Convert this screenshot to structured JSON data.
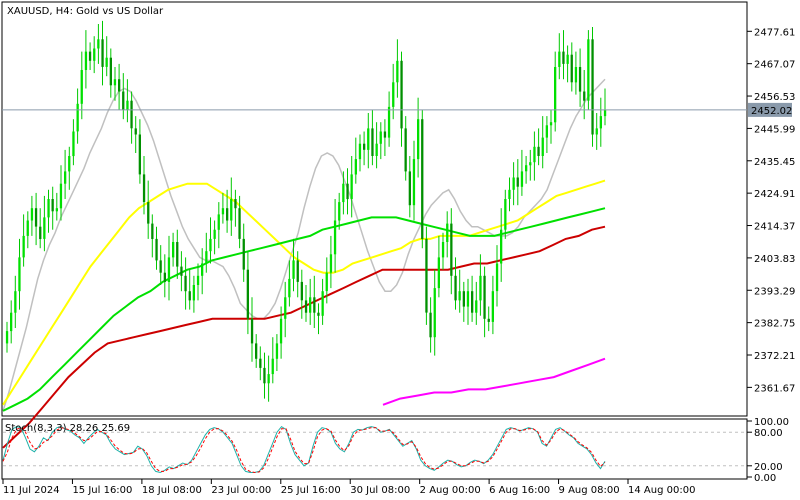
{
  "chart_data": {
    "type": "line",
    "title": "XAUUSD, H4:  Gold vs US Dollar",
    "symbol": "XAUUSD",
    "timeframe": "H4",
    "description": "Gold vs US Dollar",
    "price_axis": {
      "ylim": [
        2353.0,
        2486.5
      ],
      "ticks": [
        "2477.61",
        "2467.07",
        "2456.53",
        "2445.99",
        "2435.45",
        "2424.91",
        "2414.37",
        "2403.83",
        "2393.29",
        "2382.75",
        "2372.21",
        "2361.67"
      ]
    },
    "current_price": "2452.02",
    "time_axis": {
      "labels": [
        "11 Jul 2024",
        "15 Jul 16:00",
        "18 Jul 08:00",
        "23 Jul 00:00",
        "25 Jul 16:00",
        "30 Jul 08:00",
        "2 Aug 00:00",
        "6 Aug 16:00",
        "9 Aug 08:00",
        "14 Aug 00:00"
      ]
    },
    "candles_close": [
      2380,
      2386,
      2393,
      2404,
      2411,
      2416,
      2420,
      2414,
      2410,
      2417,
      2423,
      2419,
      2420,
      2428,
      2432,
      2437,
      2445,
      2454,
      2465,
      2471,
      2468,
      2472,
      2475,
      2466,
      2469,
      2460,
      2462,
      2458,
      2452,
      2455,
      2446,
      2444,
      2431,
      2422,
      2415,
      2410,
      2403,
      2399,
      2396,
      2404,
      2409,
      2401,
      2398,
      2393,
      2390,
      2395,
      2398,
      2402,
      2406,
      2410,
      2413,
      2418,
      2420,
      2416,
      2423,
      2420,
      2410,
      2400,
      2384,
      2376,
      2371,
      2368,
      2363,
      2366,
      2371,
      2376,
      2384,
      2391,
      2397,
      2403,
      2396,
      2390,
      2386,
      2391,
      2386,
      2385,
      2393,
      2399,
      2405,
      2416,
      2422,
      2428,
      2423,
      2431,
      2436,
      2441,
      2439,
      2446,
      2437,
      2441,
      2445,
      2443,
      2453,
      2461,
      2468,
      2446,
      2432,
      2421,
      2436,
      2449,
      2410,
      2386,
      2378,
      2394,
      2404,
      2409,
      2415,
      2398,
      2390,
      2393,
      2388,
      2393,
      2386,
      2390,
      2398,
      2384,
      2383,
      2393,
      2402,
      2413,
      2423,
      2426,
      2430,
      2427,
      2432,
      2434,
      2435,
      2440,
      2437,
      2443,
      2447,
      2448,
      2466,
      2471,
      2467,
      2470,
      2461,
      2466,
      2458,
      2455,
      2475,
      2444,
      2446,
      2450,
      2452
    ],
    "series": [
      {
        "name": "MA20 (silver)",
        "color": "#c0c0c0",
        "values": [
          2354,
          2360,
          2367,
          2374,
          2381,
          2389,
          2397,
          2403,
          2408,
          2412,
          2417,
          2421,
          2425,
          2429,
          2433,
          2438,
          2442,
          2446,
          2451,
          2455,
          2458,
          2459,
          2458,
          2455,
          2451,
          2447,
          2442,
          2436,
          2430,
          2424,
          2419,
          2414,
          2410,
          2407,
          2404,
          2403,
          2403,
          2402,
          2401,
          2398,
          2394,
          2389,
          2387,
          2385,
          2384,
          2384,
          2386,
          2389,
          2394,
          2400,
          2406,
          2412,
          2420,
          2427,
          2433,
          2437,
          2438,
          2437,
          2434,
          2429,
          2424,
          2418,
          2412,
          2406,
          2401,
          2396,
          2393,
          2393,
          2395,
          2399,
          2405,
          2410,
          2414,
          2418,
          2421,
          2423,
          2425,
          2426,
          2423,
          2419,
          2416,
          2414,
          2414,
          2413,
          2412,
          2411,
          2411,
          2411,
          2412,
          2414,
          2417,
          2419,
          2421,
          2423,
          2426,
          2431,
          2436,
          2441,
          2446,
          2450,
          2453,
          2456,
          2458,
          2460,
          2462
        ]
      },
      {
        "name": "MA50 (yellow)",
        "color": "#ffff00",
        "values": [
          2356,
          2361,
          2366,
          2371,
          2376,
          2381,
          2386,
          2391,
          2396,
          2401,
          2405,
          2409,
          2413,
          2417,
          2420,
          2422,
          2424,
          2426,
          2427,
          2428,
          2428,
          2428,
          2426,
          2424,
          2422,
          2419,
          2416,
          2413,
          2410,
          2407,
          2404,
          2402,
          2400,
          2399,
          2399,
          2400,
          2402,
          2403,
          2404,
          2405,
          2406,
          2407,
          2409,
          2410,
          2410,
          2411,
          2411,
          2411,
          2411,
          2412,
          2413,
          2414,
          2415,
          2416,
          2418,
          2420,
          2422,
          2424,
          2425,
          2426,
          2427,
          2428,
          2429
        ]
      },
      {
        "name": "MA100 (green)",
        "color": "#00e000",
        "values": [
          2354,
          2356,
          2358,
          2361,
          2365,
          2369,
          2373,
          2377,
          2381,
          2385,
          2388,
          2391,
          2393,
          2396,
          2398,
          2400,
          2401,
          2403,
          2404,
          2405,
          2406,
          2407,
          2408,
          2409,
          2410,
          2411,
          2413,
          2414,
          2415,
          2416,
          2417,
          2417,
          2417,
          2416,
          2415,
          2414,
          2413,
          2412,
          2411,
          2411,
          2411,
          2412,
          2413,
          2414,
          2415,
          2416,
          2417,
          2418,
          2419,
          2420
        ]
      },
      {
        "name": "MA200 (red)",
        "color": "#cc0000",
        "values": [
          2342,
          2346,
          2350,
          2355,
          2360,
          2365,
          2369,
          2373,
          2376,
          2377,
          2378,
          2379,
          2380,
          2381,
          2382,
          2383,
          2384,
          2384,
          2384,
          2384,
          2384,
          2385,
          2386,
          2388,
          2390,
          2392,
          2394,
          2396,
          2398,
          2400,
          2400,
          2400,
          2400,
          2400,
          2400,
          2401,
          2402,
          2402,
          2403,
          2404,
          2405,
          2406,
          2408,
          2410,
          2411,
          2413,
          2414
        ]
      },
      {
        "name": "MA (magenta)",
        "color": "#ff00ff",
        "values": [
          2356,
          2358,
          2359,
          2360,
          2360,
          2361,
          2361,
          2362,
          2363,
          2364,
          2365,
          2367,
          2369,
          2371
        ]
      }
    ],
    "stochastic": {
      "label": "Stoch(8,3,3) 28.26 25.69",
      "main_value": 28.26,
      "signal_value": 25.69,
      "ylim": [
        0,
        100
      ],
      "levels": [
        80,
        20
      ],
      "ticks": [
        "100.00",
        "80.00",
        "20.00",
        "0.00"
      ],
      "main": [
        30,
        60,
        85,
        90,
        88,
        70,
        50,
        45,
        55,
        70,
        65,
        80,
        88,
        90,
        85,
        82,
        75,
        70,
        60,
        70,
        78,
        85,
        80,
        75,
        60,
        50,
        45,
        40,
        42,
        44,
        55,
        50,
        38,
        20,
        10,
        8,
        12,
        18,
        15,
        20,
        25,
        22,
        30,
        45,
        60,
        75,
        85,
        88,
        86,
        80,
        70,
        60,
        40,
        20,
        10,
        8,
        8,
        10,
        20,
        40,
        60,
        80,
        90,
        85,
        60,
        40,
        30,
        20,
        25,
        55,
        80,
        88,
        86,
        80,
        60,
        50,
        45,
        60,
        80,
        85,
        84,
        88,
        90,
        88,
        80,
        82,
        85,
        75,
        65,
        55,
        60,
        65,
        50,
        30,
        20,
        15,
        12,
        18,
        25,
        30,
        28,
        22,
        18,
        20,
        26,
        30,
        28,
        24,
        30,
        40,
        55,
        70,
        85,
        88,
        86,
        82,
        85,
        88,
        86,
        80,
        60,
        55,
        70,
        85,
        88,
        82,
        75,
        70,
        60,
        55,
        50,
        40,
        25,
        15,
        28
      ],
      "signal": [
        28,
        45,
        70,
        85,
        88,
        80,
        62,
        50,
        52,
        62,
        66,
        74,
        84,
        88,
        86,
        84,
        78,
        72,
        65,
        67,
        74,
        81,
        81,
        77,
        66,
        55,
        48,
        42,
        41,
        43,
        50,
        51,
        43,
        28,
        15,
        10,
        10,
        15,
        15,
        18,
        22,
        23,
        27,
        38,
        52,
        68,
        80,
        86,
        86,
        82,
        74,
        64,
        48,
        28,
        14,
        10,
        8,
        9,
        16,
        32,
        52,
        72,
        86,
        86,
        68,
        46,
        34,
        24,
        24,
        46,
        72,
        84,
        86,
        82,
        66,
        54,
        47,
        56,
        74,
        83,
        84,
        86,
        88,
        88,
        82,
        82,
        84,
        78,
        68,
        58,
        59,
        63,
        53,
        36,
        24,
        17,
        14,
        16,
        22,
        28,
        28,
        24,
        20,
        20,
        24,
        28,
        28,
        25,
        28,
        36,
        50,
        65,
        80,
        86,
        86,
        83,
        84,
        86,
        86,
        81,
        65,
        57,
        66,
        80,
        86,
        83,
        77,
        71,
        63,
        57,
        52,
        44,
        30,
        19,
        26
      ]
    }
  }
}
